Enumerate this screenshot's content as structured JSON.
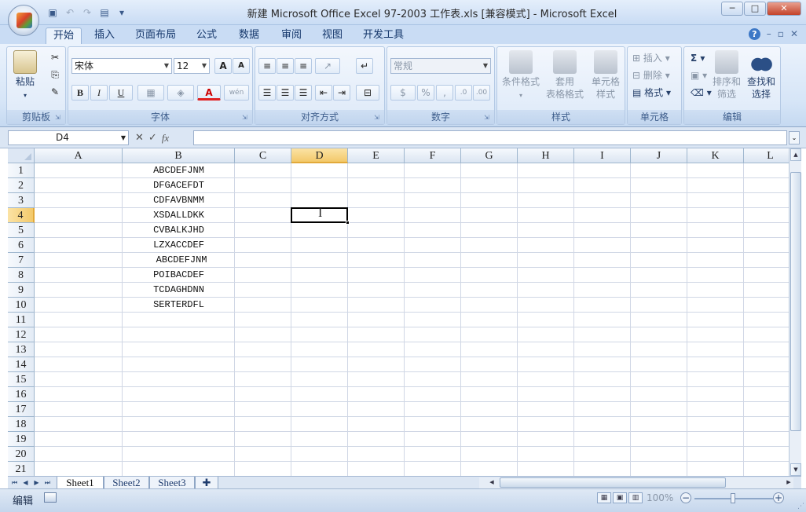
{
  "window": {
    "title": "新建 Microsoft Office Excel 97-2003 工作表.xls  [兼容模式] - Microsoft Excel",
    "controls": [
      "─",
      "□",
      "✕"
    ]
  },
  "quick_access": [
    "save-icon",
    "undo-icon",
    "redo-icon",
    "print-preview-icon",
    "customize-icon"
  ],
  "ribbon_tabs": [
    "开始",
    "插入",
    "页面布局",
    "公式",
    "数据",
    "审阅",
    "视图",
    "开发工具"
  ],
  "ribbon_controls": [
    "?",
    "–",
    "▫",
    "✕"
  ],
  "ribbon": {
    "clipboard": {
      "label": "剪贴板",
      "paste": "粘贴"
    },
    "font": {
      "label": "字体",
      "font_name": "宋体",
      "font_size": "12",
      "bold": "B",
      "italic": "I",
      "underline": "U",
      "grow": "A",
      "shrink": "A",
      "font_color": "A",
      "phonetic": "wén"
    },
    "alignment": {
      "label": "对齐方式"
    },
    "number": {
      "label": "数字",
      "format": "常规",
      "percent": "%",
      "comma": ","
    },
    "styles": {
      "label": "样式",
      "conditional": "条件格式",
      "table_line1": "套用",
      "table_line2": "表格格式",
      "cell_line1": "单元格",
      "cell_line2": "样式"
    },
    "cells": {
      "label": "单元格",
      "insert": "插入",
      "delete": "删除",
      "format": "格式"
    },
    "editing": {
      "label": "编辑",
      "sum": "Σ",
      "sort_line1": "排序和",
      "sort_line2": "筛选",
      "find_line1": "查找和",
      "find_line2": "选择"
    }
  },
  "formula_bar": {
    "name_box": "D4",
    "fx": "fx",
    "formula": ""
  },
  "grid": {
    "columns": [
      "A",
      "B",
      "C",
      "D",
      "E",
      "F",
      "G",
      "H",
      "I",
      "J",
      "K",
      "L"
    ],
    "rows": [
      "1",
      "2",
      "3",
      "4",
      "5",
      "6",
      "7",
      "8",
      "9",
      "10",
      "11",
      "12",
      "13",
      "14",
      "15",
      "16",
      "17",
      "18",
      "19",
      "20",
      "21"
    ],
    "selected_column": "D",
    "selected_row": "4",
    "column_b_values": [
      "ABCDEFJNM",
      "DFGACEFDT",
      "CDFAVBNMM",
      "XSDALLDKK",
      "CVBALKJHD",
      "LZXACCDEF",
      " ABCDEFJNM",
      "POIBACDEF",
      "TCDAGHDNN",
      "SERTERDFL"
    ]
  },
  "sheets": [
    "Sheet1",
    "Sheet2",
    "Sheet3"
  ],
  "active_sheet": "Sheet1",
  "status": {
    "mode": "编辑",
    "zoom": "100%"
  }
}
